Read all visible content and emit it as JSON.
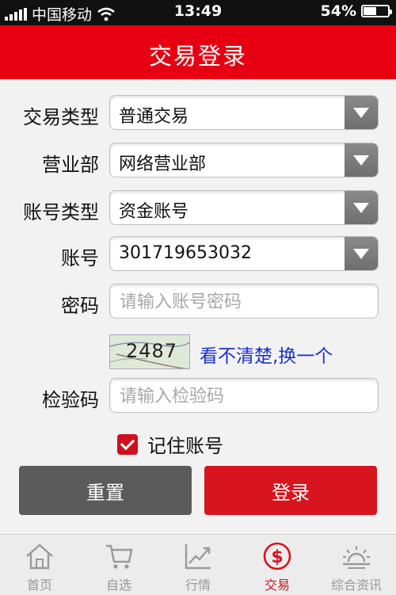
{
  "status_bar": {
    "carrier": "中国移动",
    "time": "13:49",
    "battery": "54%",
    "battery_level": 0.54,
    "signal_icon": "signal-bars-icon",
    "wifi_icon": "wifi-icon"
  },
  "header": {
    "title": "交易登录"
  },
  "form": {
    "trade_type": {
      "label": "交易类型",
      "value": "普通交易"
    },
    "branch": {
      "label": "营业部",
      "value": "网络营业部"
    },
    "account_type": {
      "label": "账号类型",
      "value": "资金账号"
    },
    "account": {
      "label": "账号",
      "value": "301719653032"
    },
    "password": {
      "label": "密码",
      "placeholder": "请输入账号密码"
    },
    "captcha": {
      "image_code": "2487",
      "refresh_label": "看不清楚,换一个"
    },
    "verify": {
      "label": "检验码",
      "placeholder": "请输入检验码"
    },
    "remember": {
      "label": "记住账号",
      "checked": true
    }
  },
  "buttons": {
    "reset": "重置",
    "login": "登录"
  },
  "tabs": [
    {
      "label": "首页",
      "icon": "home-icon",
      "active": false
    },
    {
      "label": "自选",
      "icon": "cart-icon",
      "active": false
    },
    {
      "label": "行情",
      "icon": "chart-trend-icon",
      "active": false
    },
    {
      "label": "交易",
      "icon": "dollar-circle-icon",
      "active": true
    },
    {
      "label": "综合资讯",
      "icon": "sunrise-news-icon",
      "active": false
    }
  ],
  "colors": {
    "brand_red": "#e60012",
    "active_tab": "#d8141e",
    "link_blue": "#1a33cc",
    "reset_gray": "#5b5b5b"
  }
}
